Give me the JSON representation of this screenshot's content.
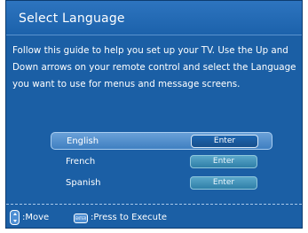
{
  "window": {
    "title": "Select Language"
  },
  "instructions": "Follow this guide to help you set up your TV. Use the Up and Down arrows on your remote control and select the Language you want to use for menus and message screens.",
  "languages": [
    {
      "label": "English",
      "button": "Enter",
      "selected": true
    },
    {
      "label": "French",
      "button": "Enter",
      "selected": false
    },
    {
      "label": "Spanish",
      "button": "Enter",
      "selected": false
    }
  ],
  "footer": {
    "move_icon": "updown-arrows-icon",
    "move_label": ":Move",
    "enter_icon": "enter-key-icon",
    "enter_icon_text": "ENTER",
    "execute_label": ":Press to Execute"
  },
  "colors": {
    "background": "#1b5fa5",
    "selected_row": "#4f8cca",
    "button": "#3f93bb"
  }
}
